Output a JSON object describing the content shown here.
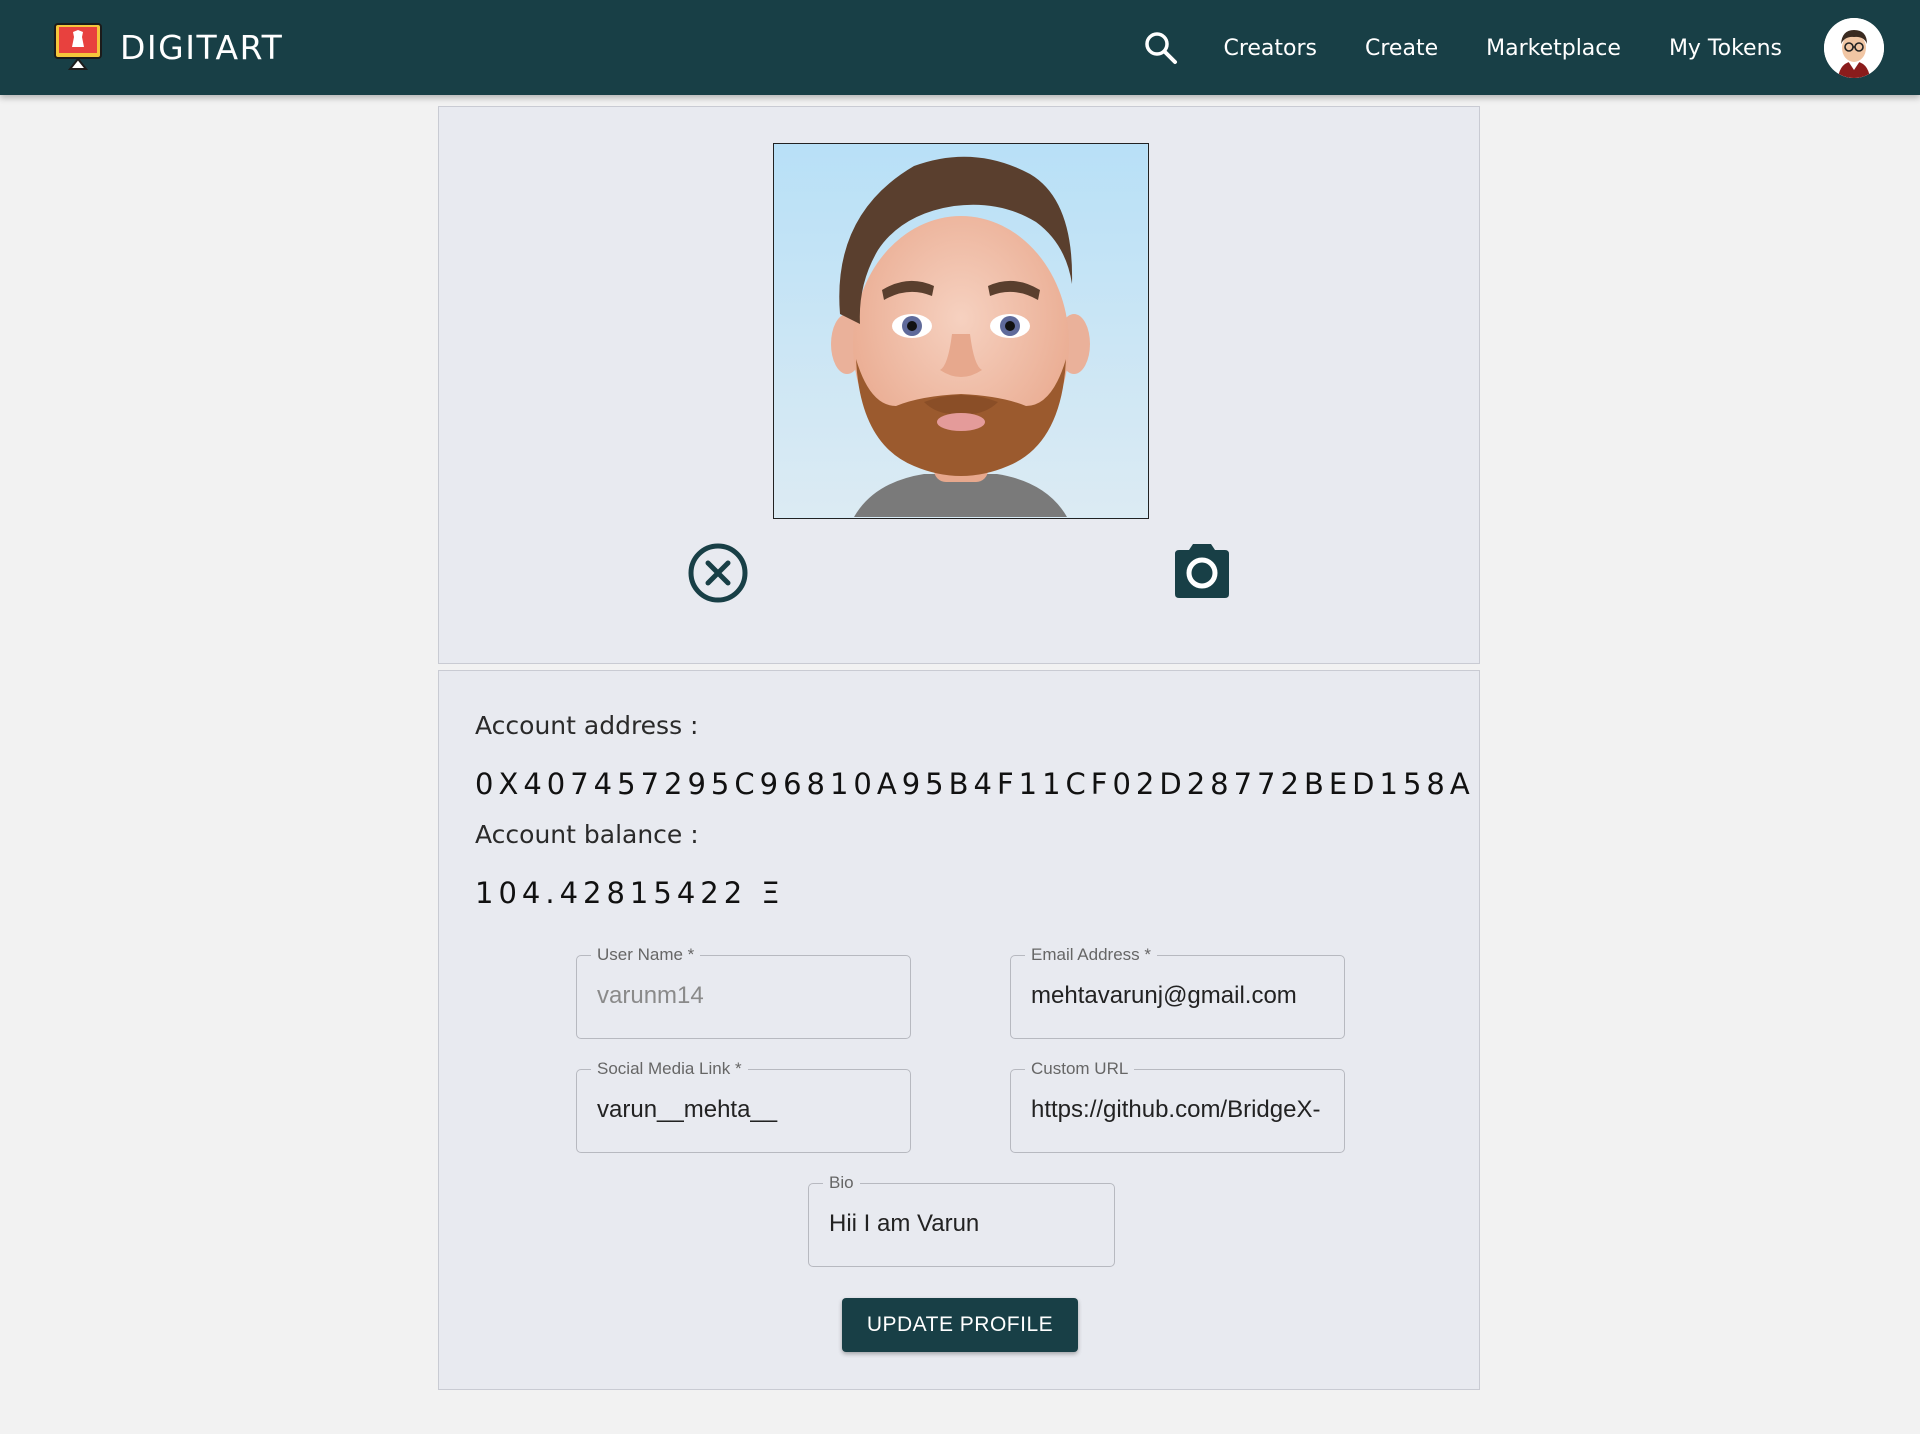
{
  "nav": {
    "brand": "DIGITART",
    "links": [
      "Creators",
      "Create",
      "Marketplace",
      "My Tokens"
    ]
  },
  "account": {
    "address_label": "Account address :",
    "address": "0X407457295C96810A95B4F11CF02D28772BED158A",
    "balance_label": "Account balance :",
    "balance": "104.42815422 Ξ"
  },
  "form": {
    "username": {
      "label": "User Name *",
      "value": "varunm14"
    },
    "email": {
      "label": "Email Address *",
      "value": "mehtavarunj@gmail.com"
    },
    "social": {
      "label": "Social Media Link *",
      "value": "varun__mehta__"
    },
    "custom_url": {
      "label": "Custom URL",
      "value": "https://github.com/BridgeX-"
    },
    "bio": {
      "label": "Bio",
      "value": "Hii I am Varun"
    },
    "submit_label": "UPDATE PROFILE"
  },
  "colors": {
    "navbar": "#183f46",
    "card": "#e8eaf0",
    "page": "#f2f2f2"
  },
  "icons": [
    "monitor-logo-icon",
    "search-icon",
    "avatar",
    "remove-photo-icon",
    "camera-icon"
  ]
}
